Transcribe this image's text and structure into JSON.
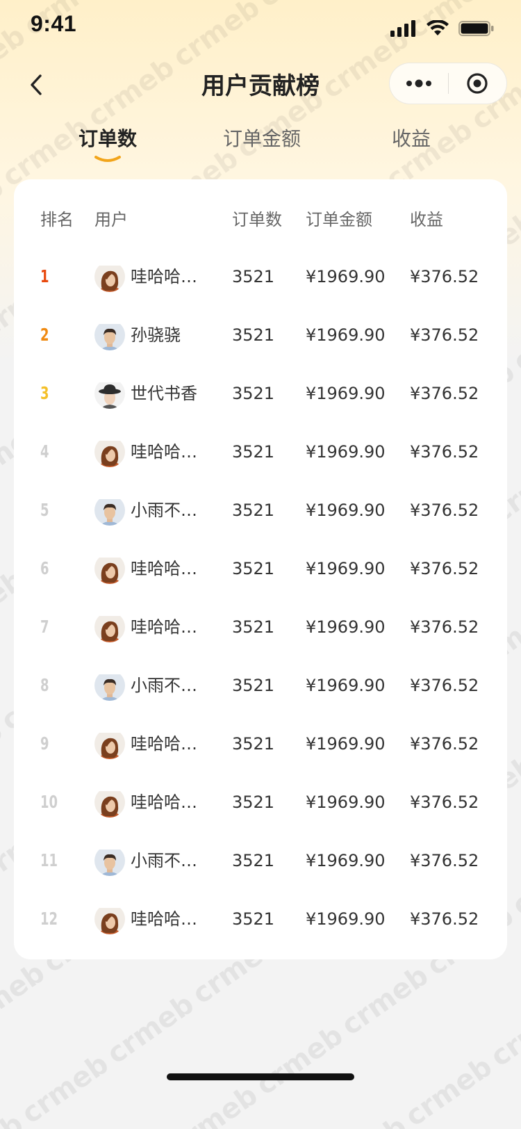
{
  "status_bar": {
    "time": "9:41",
    "icons": [
      "signal-icon",
      "wifi-icon",
      "battery-icon"
    ]
  },
  "nav": {
    "title": "用户贡献榜",
    "back_icon": "chevron-left-icon",
    "capsule_icons": [
      "more-dots-icon",
      "target-icon"
    ]
  },
  "tabs": [
    {
      "label": "订单数",
      "active": true
    },
    {
      "label": "订单金额",
      "active": false
    },
    {
      "label": "收益",
      "active": false
    }
  ],
  "table": {
    "headers": {
      "rank": "排名",
      "user": "用户",
      "orders": "订单数",
      "amount": "订单金额",
      "income": "收益"
    },
    "rows": [
      {
        "rank": "1",
        "name": "哇哈哈哈...",
        "avatar": "woman",
        "orders": "3521",
        "amount": "¥1969.90",
        "income": "¥376.52"
      },
      {
        "rank": "2",
        "name": "孙骁骁",
        "avatar": "man",
        "orders": "3521",
        "amount": "¥1969.90",
        "income": "¥376.52"
      },
      {
        "rank": "3",
        "name": "世代书香",
        "avatar": "hat",
        "orders": "3521",
        "amount": "¥1969.90",
        "income": "¥376.52"
      },
      {
        "rank": "4",
        "name": "哇哈哈哈...",
        "avatar": "woman",
        "orders": "3521",
        "amount": "¥1969.90",
        "income": "¥376.52"
      },
      {
        "rank": "5",
        "name": "小雨不吃草",
        "avatar": "man",
        "orders": "3521",
        "amount": "¥1969.90",
        "income": "¥376.52"
      },
      {
        "rank": "6",
        "name": "哇哈哈哈...",
        "avatar": "woman",
        "orders": "3521",
        "amount": "¥1969.90",
        "income": "¥376.52"
      },
      {
        "rank": "7",
        "name": "哇哈哈哈...",
        "avatar": "woman",
        "orders": "3521",
        "amount": "¥1969.90",
        "income": "¥376.52"
      },
      {
        "rank": "8",
        "name": "小雨不吃草",
        "avatar": "man",
        "orders": "3521",
        "amount": "¥1969.90",
        "income": "¥376.52"
      },
      {
        "rank": "9",
        "name": "哇哈哈哈...",
        "avatar": "woman",
        "orders": "3521",
        "amount": "¥1969.90",
        "income": "¥376.52"
      },
      {
        "rank": "10",
        "name": "哇哈哈哈...",
        "avatar": "woman",
        "orders": "3521",
        "amount": "¥1969.90",
        "income": "¥376.52"
      },
      {
        "rank": "11",
        "name": "小雨不吃草",
        "avatar": "man",
        "orders": "3521",
        "amount": "¥1969.90",
        "income": "¥376.52"
      },
      {
        "rank": "12",
        "name": "哇哈哈哈...",
        "avatar": "woman",
        "orders": "3521",
        "amount": "¥1969.90",
        "income": "¥376.52"
      }
    ]
  },
  "watermark": {
    "text": "crmeb"
  },
  "colors": {
    "header_bg": "#fff0c9",
    "rank_1": "#e8490f",
    "rank_2": "#f08a12",
    "rank_3": "#f4c02a",
    "rank_other": "#cfcfcf",
    "tab_underline": "#f2a51b"
  }
}
